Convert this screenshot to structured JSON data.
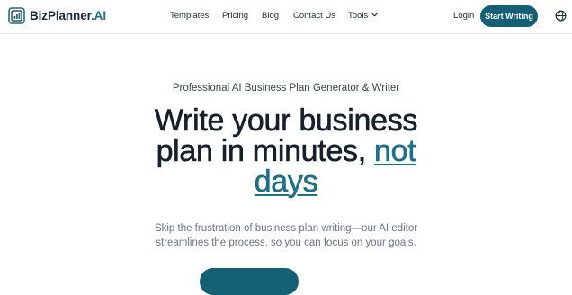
{
  "nav": {
    "brand_main": "BizPlanner",
    "brand_suffix": ".AI",
    "links": [
      "Templates",
      "Pricing",
      "Blog",
      "Contact Us",
      "Tools"
    ],
    "login": "Login",
    "cta": "Start Writing",
    "icons": {
      "logo": "logo-mark",
      "tools_dropdown": "chevron-down-icon",
      "language": "globe-icon"
    }
  },
  "hero": {
    "subtitle": "Professional AI Business Plan Generator & Writer",
    "headline_line1": "Write your business",
    "headline_line2": "plan in minutes, ",
    "headline_accent_1": "not",
    "headline_accent_2": "days",
    "description": "Skip the frustration of business plan writing—our AI editor streamlines the process, so you can focus on your goals."
  },
  "colors": {
    "accent": "#1f6f86",
    "button": "#145f73",
    "heading": "#16202b",
    "body_text": "#6b7480"
  }
}
